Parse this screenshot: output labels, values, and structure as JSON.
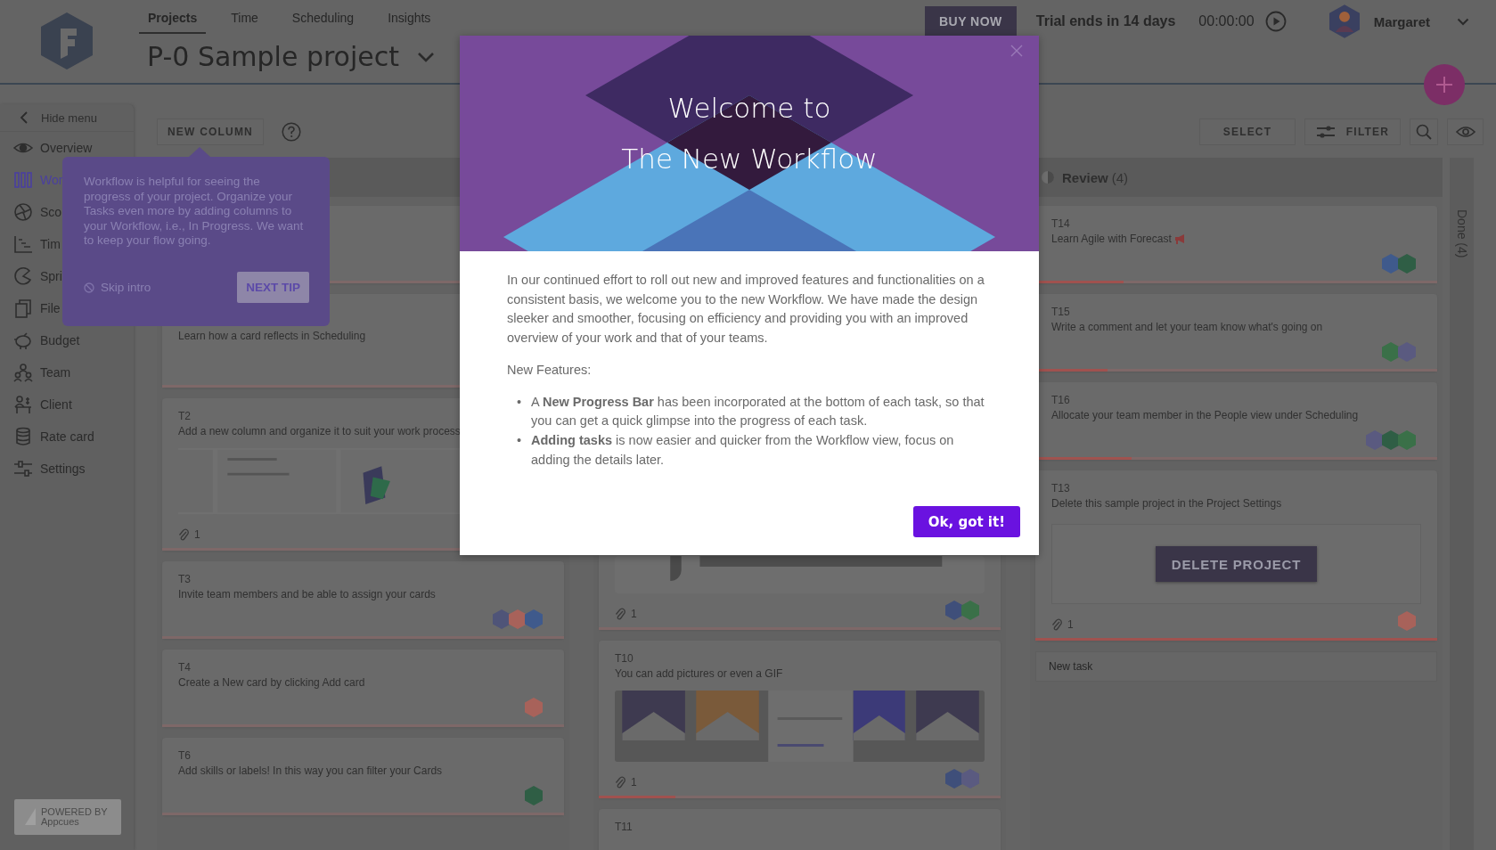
{
  "header": {
    "nav": [
      {
        "label": "Projects",
        "selected": true
      },
      {
        "label": "Time",
        "selected": false
      },
      {
        "label": "Scheduling",
        "selected": false
      },
      {
        "label": "Insights",
        "selected": false
      }
    ],
    "project_title": "P-0 Sample project",
    "buy_button": "BUY NOW",
    "trial": "Trial ends in 14 days",
    "timer": "00:00:00",
    "user": "Margaret"
  },
  "sidebar": {
    "hide": "Hide menu",
    "items": [
      {
        "label": "Overview",
        "selected": false
      },
      {
        "label": "Wor",
        "selected": true
      },
      {
        "label": "Sco",
        "selected": false
      },
      {
        "label": "Tim",
        "selected": false
      },
      {
        "label": "Spri",
        "selected": false
      },
      {
        "label": "File",
        "selected": false
      },
      {
        "label": "Budget",
        "selected": false
      },
      {
        "label": "Team",
        "selected": false
      },
      {
        "label": "Client",
        "selected": false
      },
      {
        "label": "Rate card",
        "selected": false
      },
      {
        "label": "Settings",
        "selected": false
      }
    ]
  },
  "powered_by": [
    "POWERED BY",
    "Appcues"
  ],
  "toolbar": {
    "new_column": "NEW COLUMN",
    "select": "SELECT",
    "filter": "FILTER"
  },
  "tooltip": {
    "text": "Workflow is helpful for seeing the progress of your project. Organize your Tasks even more by adding columns to your Workflow, i.e., In Progress. We want to keep your flow going.",
    "skip": "Skip intro",
    "next": "NEXT TIP"
  },
  "columns": [
    {
      "cards": [
        {
          "level": 0
        },
        {
          "title": "Learn how a card reflects in Scheduling",
          "level": 0
        },
        {
          "id": "T2",
          "title": "Add a new column and organize it to suit your work process",
          "image": true,
          "attachments": "1",
          "level": 0
        },
        {
          "id": "T3",
          "title": "Invite team members and be able to assign your cards",
          "avatars": [
            {
              "color": "#4f5478"
            },
            {
              "color": "#a8625a"
            },
            {
              "color": "#3f5a8c"
            }
          ],
          "level": 0
        },
        {
          "id": "T4",
          "title": "Create a New card by clicking Add card",
          "avatars": [
            {
              "color": "#a8625a"
            }
          ],
          "level": 0
        },
        {
          "id": "T6",
          "title": "Add skills or labels! In this way you can filter your Cards",
          "avatars": [
            {
              "color": "#2f5e45"
            }
          ],
          "level": 0
        }
      ]
    },
    {
      "cards": [
        {
          "image": true,
          "attachments": "1",
          "avatars": [
            {
              "color": "#3f4f7a"
            },
            {
              "color": "#3a7048"
            }
          ],
          "level": 0
        },
        {
          "id": "T10",
          "title": "You can add pictures or even a GIF",
          "image": true,
          "attachments": "1",
          "avatars": [
            {
              "color": "#3f4f7a"
            },
            {
              "color": "#5a5a80"
            }
          ],
          "level": 0.19
        },
        {
          "id": "T11"
        }
      ]
    },
    {
      "title": "Review",
      "count": "(4)",
      "cards": [
        {
          "id": "T14",
          "title": "Learn Agile with Forecast",
          "avatars": [
            {
              "color": "#3f5a8c"
            },
            {
              "color": "#2f5e45"
            }
          ],
          "level": 0.22
        },
        {
          "id": "T15",
          "title": "Write a comment and let your team know what's going on",
          "avatars": [
            {
              "color": "#3a7048"
            },
            {
              "color": "#5a5a80"
            }
          ],
          "level": 0.18
        },
        {
          "id": "T16",
          "title": "Allocate your team member in the People view under Scheduling",
          "avatars": [
            {
              "color": "#5a5a80"
            },
            {
              "color": "#2f5e45"
            },
            {
              "color": "#3a7048"
            }
          ],
          "level": 0.24
        },
        {
          "id": "T13",
          "title": "Delete this sample project in the Project Settings",
          "button": "DELETE PROJECT",
          "attachments": "1",
          "avatars": [
            {
              "color": "#a8625a"
            }
          ],
          "level": 1
        }
      ],
      "new_task_placeholder": "New task"
    }
  ],
  "done_column": {
    "title": "Done (4)"
  },
  "modal": {
    "title_lines": [
      "Welcome to",
      "The New Workflow"
    ],
    "intro": "In our continued effort to roll out new and improved features and functionalities on a consistent basis, we welcome you to the new Workflow. We have made the design sleeker and smoother, focusing on efficiency and providing you with an improved overview of your work and that of your teams.",
    "features_label": "New Features:",
    "features": [
      {
        "bullet": "•",
        "text": "A **New Progress Bar** has been incorporated at the bottom of each task, so that you can get a quick glimpse into the progress of each task."
      },
      {
        "bullet": "•",
        "text": "**Adding tasks** is now easier and quicker from the Workflow view, focus on adding the details later."
      }
    ],
    "button": "Ok, got it!"
  }
}
